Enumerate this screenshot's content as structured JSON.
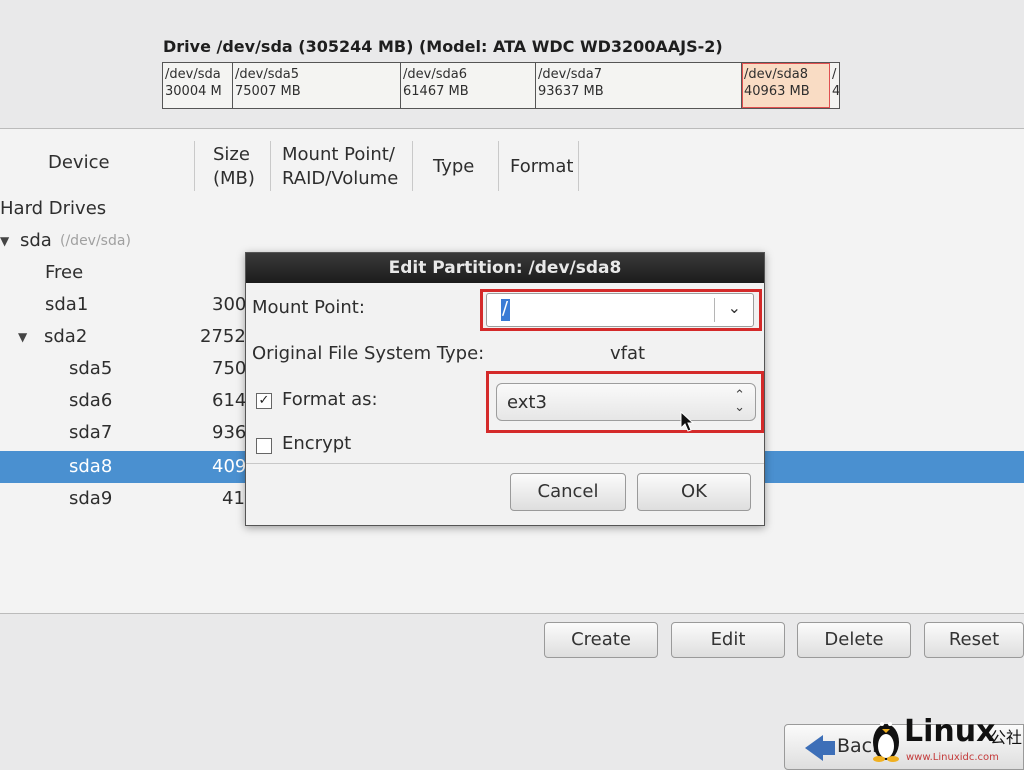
{
  "drive": {
    "title": "Drive /dev/sda (305244 MB) (Model: ATA WDC WD3200AAJS-2)",
    "segments": [
      {
        "name": "/dev/sda",
        "size": "30004 M",
        "selected": false
      },
      {
        "name": "/dev/sda5",
        "size": "75007 MB",
        "selected": false
      },
      {
        "name": "/dev/sda6",
        "size": "61467 MB",
        "selected": false
      },
      {
        "name": "/dev/sda7",
        "size": "93637 MB",
        "selected": false
      },
      {
        "name": "/dev/sda8",
        "size": "40963 MB",
        "selected": true
      },
      {
        "name": "/",
        "size": "4",
        "selected": false
      }
    ]
  },
  "columns": {
    "device": "Device",
    "size_line1": "Size",
    "size_line2": "(MB)",
    "mount_line1": "Mount Point/",
    "mount_line2": "RAID/Volume",
    "type": "Type",
    "format": "Format"
  },
  "tree": {
    "group": "Hard Drives",
    "disk": {
      "name": "sda",
      "path": "(/dev/sda)"
    },
    "rows": [
      {
        "device": "Free",
        "size": ""
      },
      {
        "device": "sda1",
        "size": "300"
      },
      {
        "device": "sda2",
        "size": "2752"
      },
      {
        "device": "sda5",
        "size": "750"
      },
      {
        "device": "sda6",
        "size": "614"
      },
      {
        "device": "sda7",
        "size": "936"
      },
      {
        "device": "sda8",
        "size": "409"
      },
      {
        "device": "sda9",
        "size": "41"
      }
    ]
  },
  "buttons": {
    "create": "Create",
    "edit": "Edit",
    "delete": "Delete",
    "reset": "Reset",
    "back": "Back"
  },
  "dialog": {
    "title": "Edit Partition: /dev/sda8",
    "mount_label": "Mount Point:",
    "mount_value": "/",
    "orig_fs_label": "Original File System Type:",
    "orig_fs_value": "vfat",
    "format_label": "Format as:",
    "format_checked": true,
    "format_value": "ext3",
    "encrypt_label": "Encrypt",
    "encrypt_checked": false,
    "cancel": "Cancel",
    "ok": "OK"
  },
  "watermark": {
    "brand": "Linux",
    "brand_cn": "公社",
    "url": "www.Linuxidc.com"
  }
}
